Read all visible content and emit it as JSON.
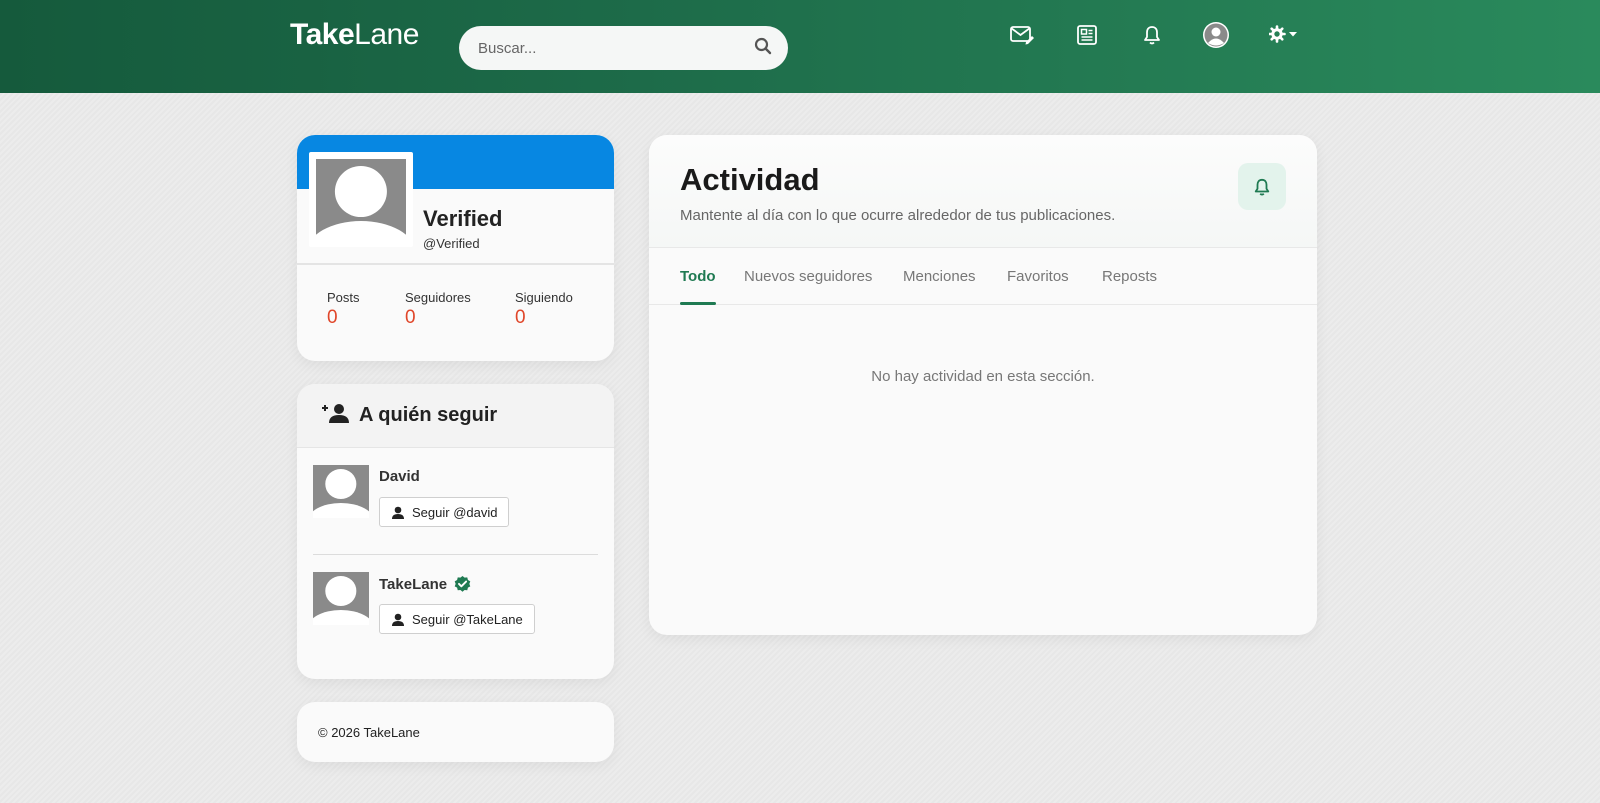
{
  "header": {
    "logo_bold": "Take",
    "logo_light": "Lane",
    "search_placeholder": "Buscar..."
  },
  "profile": {
    "name": "Verified",
    "handle": "@Verified",
    "stats": [
      {
        "label": "Posts",
        "value": "0"
      },
      {
        "label": "Seguidores",
        "value": "0"
      },
      {
        "label": "Siguiendo",
        "value": "0"
      }
    ]
  },
  "who_to_follow": {
    "title": "A quién seguir",
    "users": [
      {
        "name": "David",
        "button_label": "Seguir @david",
        "verified": false
      },
      {
        "name": "TakeLane",
        "button_label": "Seguir @TakeLane",
        "verified": true
      }
    ]
  },
  "footer": {
    "text": "© 2026 TakeLane"
  },
  "activity": {
    "title": "Actividad",
    "subtitle": "Mantente al día con lo que ocurre alrededor de tus publicaciones.",
    "tabs": [
      {
        "label": "Todo",
        "active": true
      },
      {
        "label": "Nuevos seguidores",
        "active": false
      },
      {
        "label": "Menciones",
        "active": false
      },
      {
        "label": "Favoritos",
        "active": false
      },
      {
        "label": "Reposts",
        "active": false
      }
    ],
    "empty_message": "No hay actividad en esta sección."
  },
  "colors": {
    "header_start": "#155a3c",
    "header_end": "#2a8a5c",
    "banner": "#0787e2",
    "stat_value": "#e0462a",
    "accent_green": "#1f7a52"
  },
  "icons": {
    "nav": [
      "mail-compose-icon",
      "newspaper-icon",
      "bell-icon",
      "user-avatar-icon",
      "gear-dropdown-icon"
    ]
  }
}
